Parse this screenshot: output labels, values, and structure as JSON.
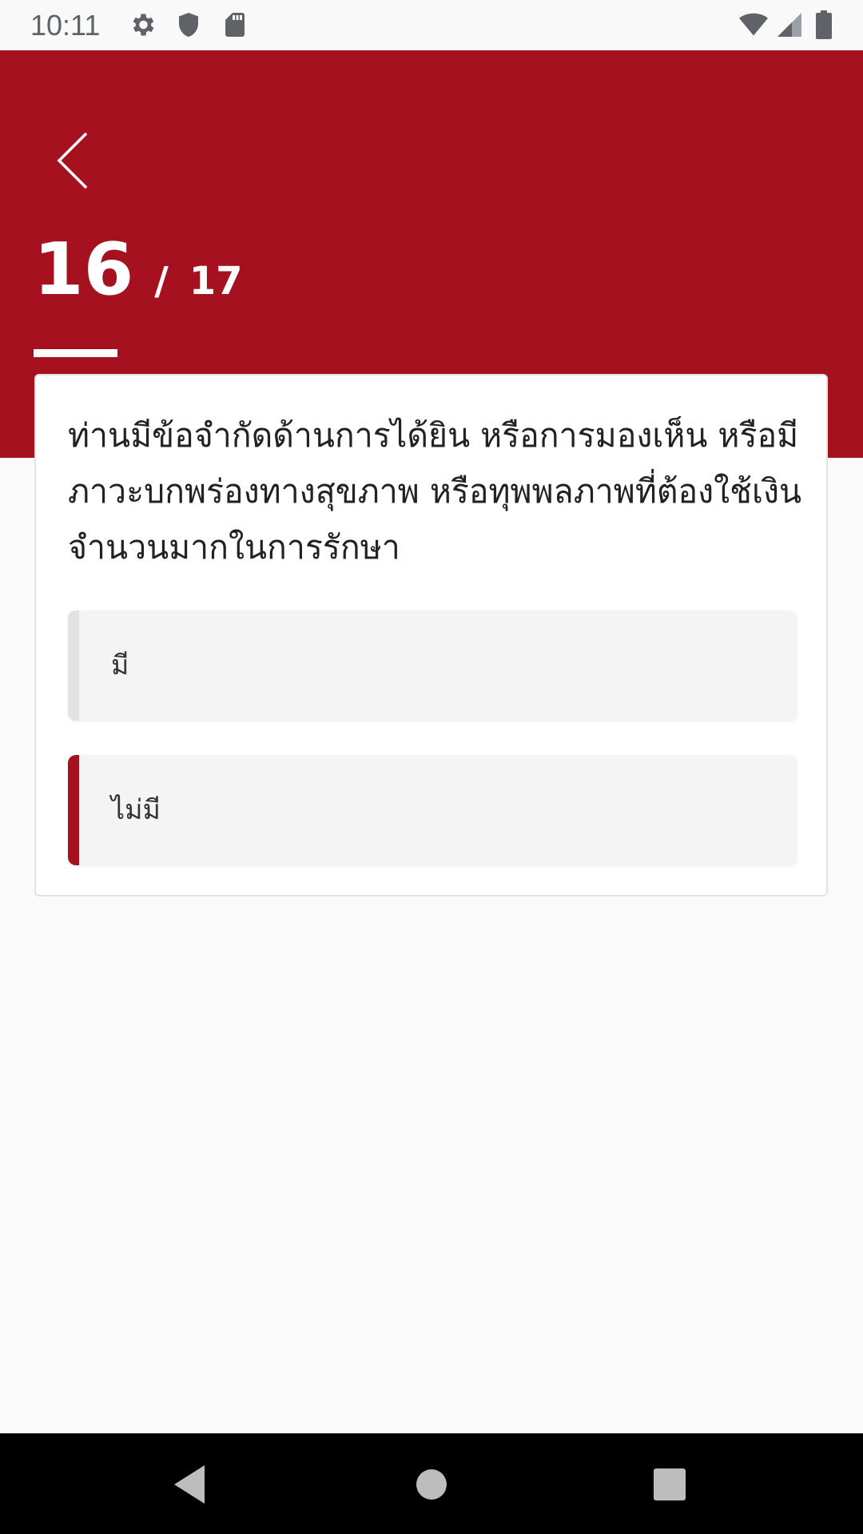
{
  "status_bar": {
    "time": "10:11",
    "left_icons": [
      "gear-icon",
      "shield-icon",
      "sd-card-icon"
    ],
    "right_icons": [
      "wifi-icon",
      "signal-icon",
      "battery-icon"
    ]
  },
  "header": {
    "background_color": "#a6111f",
    "back_icon": "chevron-left-icon",
    "progress": {
      "current": "16",
      "separator": "/",
      "total": "17"
    }
  },
  "card": {
    "question": "ท่านมีข้อจำกัดด้านการได้ยิน หรือการมองเห็น หรือมีภาวะบกพร่องทางสุขภาพ หรือทุพพลภาพที่ต้องใช้เงินจำนวนมากในการรักษา",
    "options": [
      {
        "label": "มี",
        "selected": false
      },
      {
        "label": "ไม่มี",
        "selected": true
      }
    ],
    "selected_color": "#a6111f"
  },
  "nav_bar": {
    "buttons": [
      "back-triangle-icon",
      "home-circle-icon",
      "recents-square-icon"
    ]
  }
}
